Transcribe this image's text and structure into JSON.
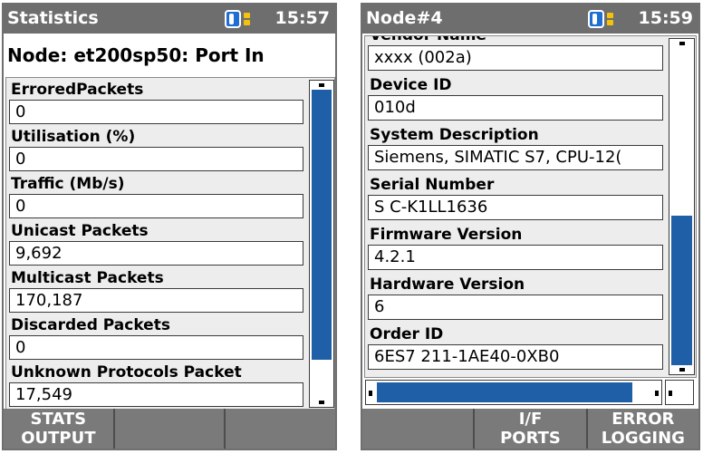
{
  "screen_left": {
    "title": "Statistics",
    "clock": "15:57",
    "node_heading": "Node: et200sp50: Port In",
    "fields": [
      {
        "label": "ErroredPackets",
        "value": "0"
      },
      {
        "label": "Utilisation (%)",
        "value": "0"
      },
      {
        "label": "Traffic (Mb/s)",
        "value": "0"
      },
      {
        "label": "Unicast Packets",
        "value": "9,692"
      },
      {
        "label": "Multicast Packets",
        "value": "170,187"
      },
      {
        "label": "Discarded Packets",
        "value": "0"
      },
      {
        "label": "Unknown Protocols Packet",
        "value": "17,549"
      }
    ],
    "softkeys": [
      {
        "line1": "STATS",
        "line2": "OUTPUT"
      },
      {
        "line1": "",
        "line2": ""
      },
      {
        "line1": "",
        "line2": ""
      }
    ]
  },
  "screen_right": {
    "title": "Node#4",
    "clock": "15:59",
    "fields": [
      {
        "label": "Vendor Name",
        "value": "xxxx (002a)"
      },
      {
        "label": "Device ID",
        "value": "010d"
      },
      {
        "label": "System Description",
        "value": "Siemens, SIMATIC S7, CPU-12("
      },
      {
        "label": "Serial Number",
        "value": "S C-K1LL1636"
      },
      {
        "label": "Firmware Version",
        "value": "4.2.1"
      },
      {
        "label": "Hardware Version",
        "value": "6"
      },
      {
        "label": "Order ID",
        "value": "6ES7 211-1AE40-0XB0"
      }
    ],
    "softkeys": [
      {
        "line1": "",
        "line2": ""
      },
      {
        "line1": "I/F",
        "line2": "PORTS"
      },
      {
        "line1": "ERROR",
        "line2": "LOGGING"
      }
    ]
  },
  "icons": [
    "battery-icon",
    "scroll-arrow-up-icon",
    "scroll-arrow-down-icon",
    "scroll-arrow-left-icon",
    "scroll-arrow-right-icon"
  ],
  "colors": {
    "titlebar": "#6e6e6e",
    "panel": "#ededed",
    "scroll_thumb": "#1f5fa8",
    "battery": "#1e6fd1",
    "battery_dots": "#f4c20d"
  }
}
